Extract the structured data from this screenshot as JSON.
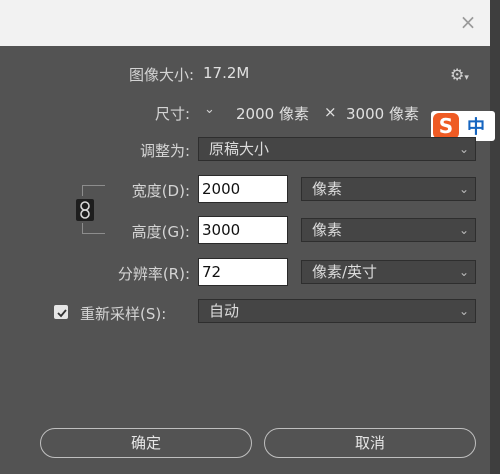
{
  "dialog": {
    "close_symbol": "×",
    "image_size": {
      "label": "图像大小:",
      "value": "17.2M"
    },
    "dimensions": {
      "label": "尺寸:",
      "width": "2000 像素",
      "times": "×",
      "height": "3000 像素"
    },
    "fit_to": {
      "label": "调整为:",
      "value": "原稿大小"
    },
    "width": {
      "label": "宽度(D):",
      "value": "2000",
      "unit": "像素"
    },
    "height": {
      "label": "高度(G):",
      "value": "3000",
      "unit": "像素"
    },
    "resolution": {
      "label": "分辨率(R):",
      "value": "72",
      "unit": "像素/英寸"
    },
    "resample": {
      "label": "重新采样(S):",
      "checked": true,
      "value": "自动"
    },
    "ok_label": "确定",
    "cancel_label": "取消",
    "ime": {
      "logo": "S",
      "mode": "中"
    }
  },
  "icons": [
    "close-icon",
    "gear-icon",
    "chevron-down-icon",
    "link-icon",
    "checkmark-icon"
  ],
  "colors": {
    "dialog_bg": "#535353",
    "titlebar_bg": "#f2f2f2",
    "input_bg": "#ffffff",
    "ime_accent": "#ef5b24"
  }
}
